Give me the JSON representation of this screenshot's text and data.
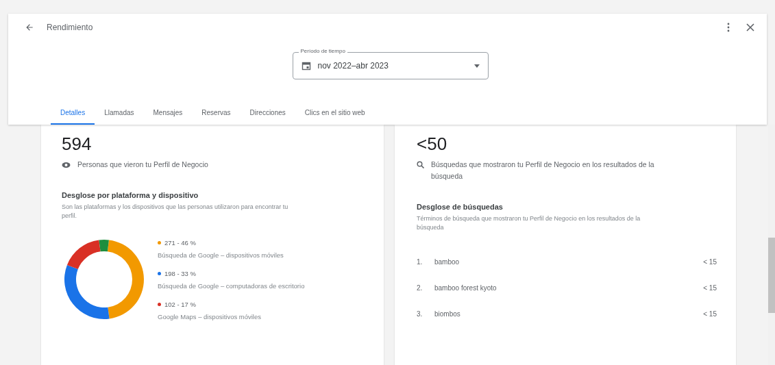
{
  "header": {
    "title": "Rendimiento"
  },
  "period_field": {
    "label": "Período de tiempo",
    "value": "nov 2022–abr 2023"
  },
  "tabs": [
    {
      "label": "Detalles",
      "selected": true
    },
    {
      "label": "Llamadas",
      "selected": false
    },
    {
      "label": "Mensajes",
      "selected": false
    },
    {
      "label": "Reservas",
      "selected": false
    },
    {
      "label": "Direcciones",
      "selected": false
    },
    {
      "label": "Clics en el sitio web",
      "selected": false
    }
  ],
  "views_card": {
    "total": "594",
    "caption": "Personas que vieron tu Perfil de Negocio",
    "breakdown_title": "Desglose por plataforma y dispositivo",
    "breakdown_description": "Son las plataformas y los dispositivos que las personas utilizaron para encontrar tu perfil.",
    "chart_data": {
      "type": "donut",
      "values": [
        46,
        33,
        17,
        4
      ],
      "colors": [
        "#f29900",
        "#1a73e8",
        "#d93025",
        "#1e8e3e"
      ]
    },
    "legend": [
      {
        "value": "271 - 46 %",
        "label": "Búsqueda de Google – dispositivos móviles",
        "color": "#f29900"
      },
      {
        "value": "198 - 33 %",
        "label": "Búsqueda de Google – computadoras de escritorio",
        "color": "#1a73e8"
      },
      {
        "value": "102 - 17 %",
        "label": "Google Maps – dispositivos móviles",
        "color": "#d93025"
      }
    ]
  },
  "searches_card": {
    "total": "<50",
    "caption": "Búsquedas que mostraron tu Perfil de Negocio en los resultados de la búsqueda",
    "breakdown_title": "Desglose de búsquedas",
    "breakdown_description": "Términos de búsqueda que mostraron tu Perfil de Negocio en los resultados de la búsqueda",
    "terms": [
      {
        "rank": "1.",
        "term": "bamboo",
        "count": "< 15"
      },
      {
        "rank": "2.",
        "term": "bamboo forest kyoto",
        "count": "< 15"
      },
      {
        "rank": "3.",
        "term": "biombos",
        "count": "< 15"
      }
    ]
  }
}
